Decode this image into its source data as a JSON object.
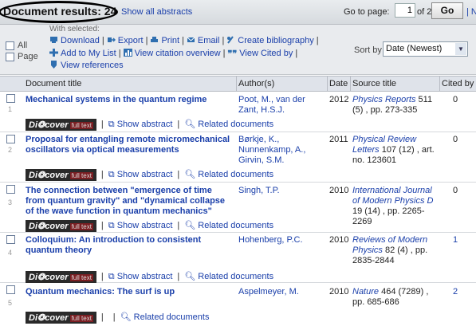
{
  "header": {
    "results_label": "Document results: 24",
    "show_all": "Show all abstracts",
    "goto_label": "Go to page:",
    "page_value": "1",
    "of_label": "of 2",
    "go_label": "Go",
    "next_label": "| Next >"
  },
  "tools": {
    "all_label": "All",
    "page_label": "Page",
    "with_selected": "With selected:",
    "download": "Download",
    "export": "Export",
    "print": "Print",
    "email": "Email",
    "bibliography": "Create bibliography",
    "add_list": "Add to My List",
    "citation_overview": "View citation overview",
    "cited_by": "View Cited by",
    "references": "View references",
    "sort_label": "Sort by",
    "sort_value": "Date (Newest)"
  },
  "columns": {
    "title": "Document title",
    "authors": "Author(s)",
    "date": "Date",
    "source": "Source title",
    "cited": "Cited by"
  },
  "actions": {
    "discover": "Di❂cover",
    "fulltext": "full text",
    "show_abstract": "Show abstract",
    "related": "Related documents"
  },
  "rows": [
    {
      "num": "1",
      "title": "Mechanical systems in the quantum regime",
      "authors": "Poot, M., van der Zant, H.S.J.",
      "date": "2012",
      "journal": "Physics Reports",
      "source_rest": " 511 (5) , pp. 273-335",
      "cited": "0"
    },
    {
      "num": "2",
      "title": "Proposal for entangling remote micromechanical oscillators via optical measurements",
      "authors": "Børkje, K., Nunnenkamp, A., Girvin, S.M.",
      "date": "2011",
      "journal": "Physical Review Letters",
      "source_rest": " 107 (12) , art. no. 123601",
      "cited": "0"
    },
    {
      "num": "3",
      "title": "The connection between \"emergence of time from quantum gravity\" and \"dynamical collapse of the wave function in quantum mechanics\"",
      "authors": "Singh, T.P.",
      "date": "2010",
      "journal": "International Journal of Modern Physics D",
      "source_rest": " 19 (14) , pp. 2265-2269",
      "cited": "0"
    },
    {
      "num": "4",
      "title": "Colloquium: An introduction to consistent quantum theory",
      "authors": "Hohenberg, P.C.",
      "date": "2010",
      "journal": "Reviews of Modern Physics",
      "source_rest": " 82 (4) , pp. 2835-2844",
      "cited": "1"
    },
    {
      "num": "5",
      "title": "Quantum mechanics: The surf is up",
      "authors": "Aspelmeyer, M.",
      "date": "2010",
      "journal": "Nature",
      "source_rest": " 464 (7289) , pp. 685-686",
      "cited": "2"
    }
  ],
  "colors": {
    "link": "#1a3faa",
    "header_bg": "#dfe3ea",
    "toolbar_bg": "#e9ebee"
  }
}
